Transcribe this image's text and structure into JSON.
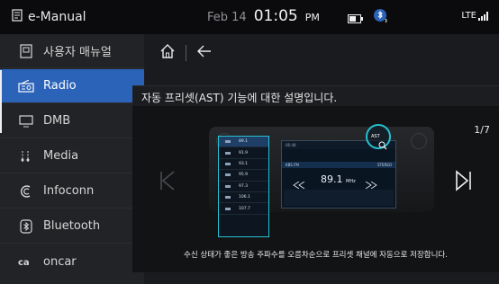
{
  "status": {
    "app_title": "e-Manual",
    "date": "Feb 14",
    "time": "01:05",
    "ampm": "PM",
    "network": "LTE"
  },
  "sidebar": {
    "items": [
      {
        "label": "사용자 매뉴얼",
        "icon": "manual-icon"
      },
      {
        "label": "Radio",
        "icon": "radio-icon"
      },
      {
        "label": "DMB",
        "icon": "monitor-icon"
      },
      {
        "label": "Media",
        "icon": "media-icon"
      },
      {
        "label": "Infoconn",
        "icon": "infoconn-icon"
      },
      {
        "label": "Bluetooth",
        "icon": "bluetooth-icon"
      },
      {
        "label": "oncar",
        "icon": "oncar-icon"
      }
    ],
    "active_index": 1
  },
  "popup": {
    "title": "자동 프리셋(AST) 기능에 대한 설명입니다.",
    "page_indicator": "1/7",
    "caption": "수신 상태가 좋은 방송 주파수를 오름차순으로 프리셋 채널에 자동으로 저장합니다."
  },
  "illustration": {
    "station": "KBS FM",
    "frequency": "89.1",
    "unit": "MHz",
    "clock": "06:48",
    "stereo_label": "STEREO",
    "ast_label": "AST",
    "presets": [
      "89.1",
      "91.9",
      "93.1",
      "95.9",
      "97.3",
      "106.1",
      "107.7"
    ]
  },
  "colors": {
    "accent": "#2a63b8",
    "highlight": "#25c1d1",
    "background": "#1a1b1e"
  }
}
